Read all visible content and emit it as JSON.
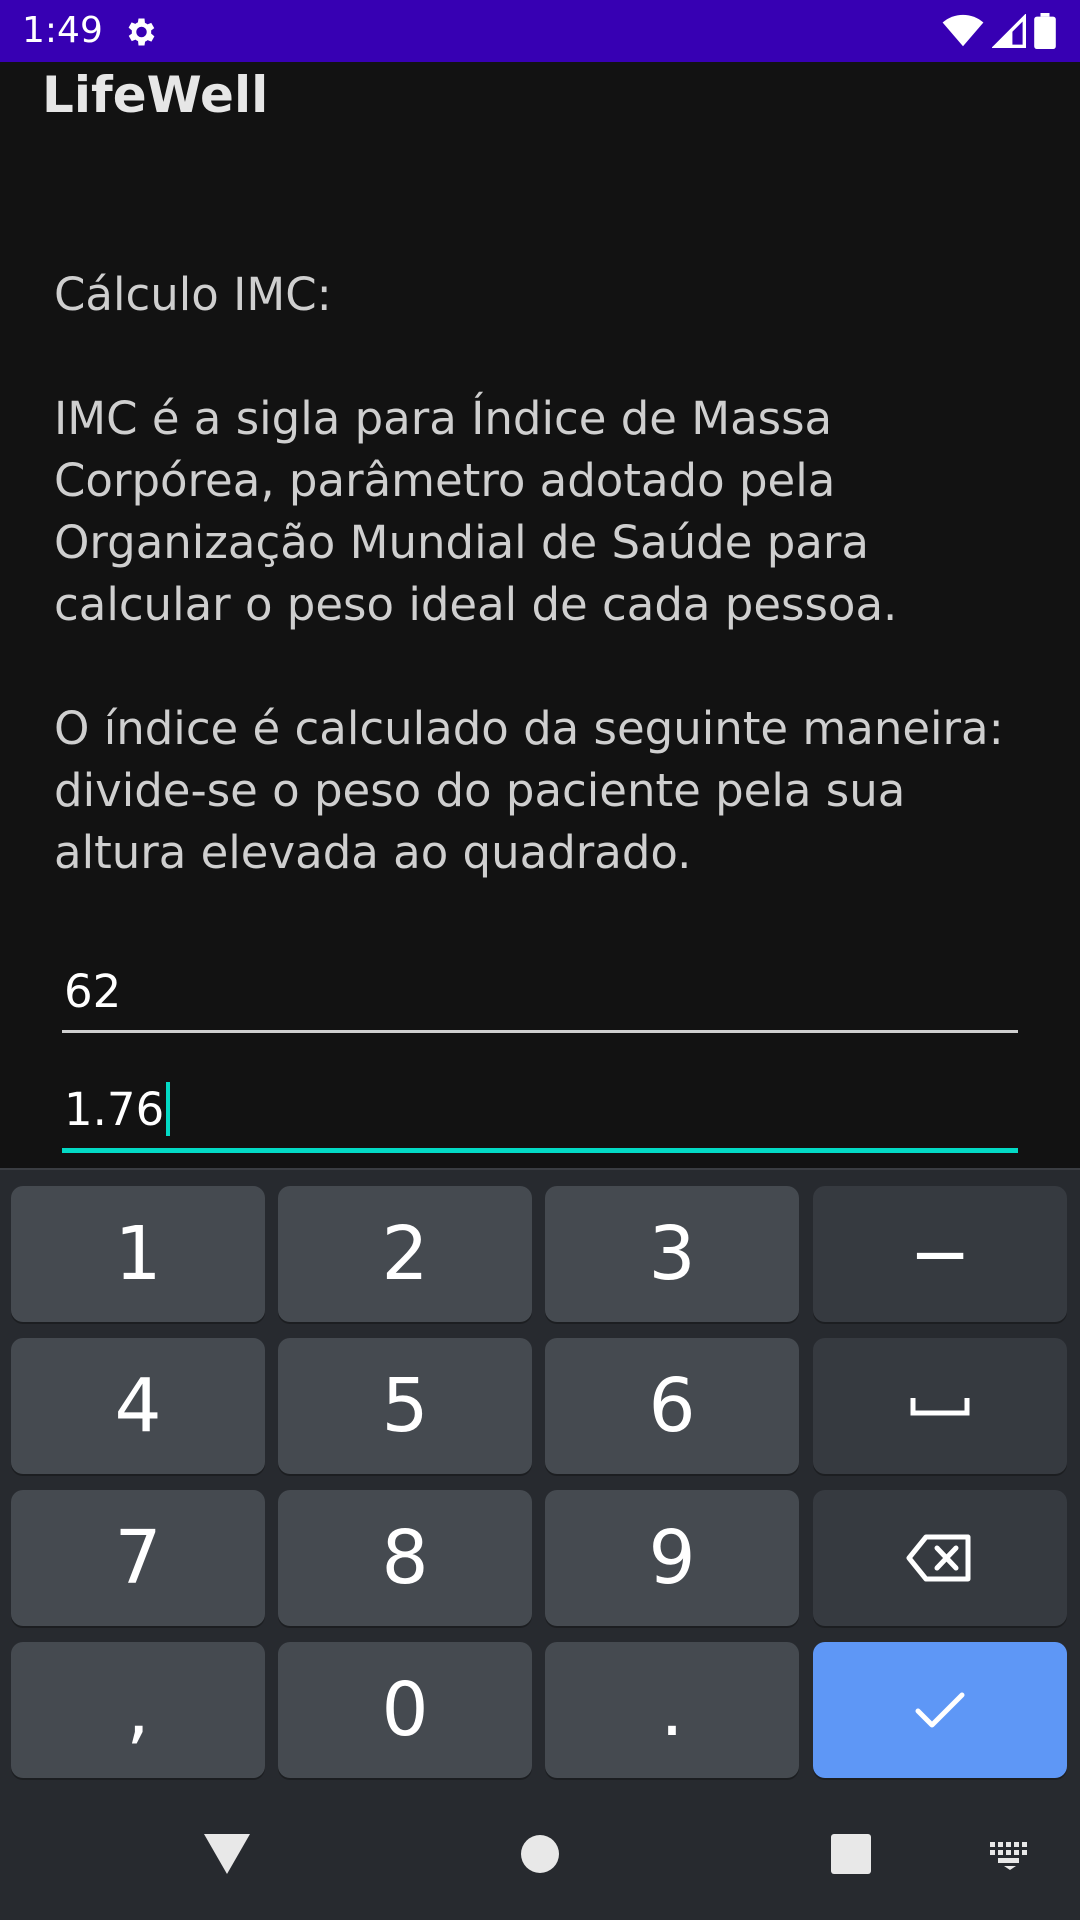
{
  "status_bar": {
    "time": "1:49",
    "icons": [
      "settings-gear-icon",
      "wifi-icon",
      "cellular-signal-icon",
      "battery-icon"
    ],
    "background": "#3700B3"
  },
  "app": {
    "title": "LifeWell"
  },
  "content": {
    "heading": "Cálculo IMC:",
    "paragraph1": "IMC é a sigla para Índice de Massa Corpórea, parâmetro adotado pela Organização Mundial de Saúde para calcular o peso ideal de cada pessoa.",
    "paragraph2": "O índice é calculado da seguinte maneira: divide-se o peso do paciente pela sua altura elevada ao quadrado."
  },
  "form": {
    "weight_value": "62",
    "height_value": "1.76",
    "accent": "#03DAC5"
  },
  "keyboard": {
    "keys": {
      "k1": "1",
      "k2": "2",
      "k3": "3",
      "minus": "−",
      "k4": "4",
      "k5": "5",
      "k6": "6",
      "k7": "7",
      "k8": "8",
      "k9": "9",
      "comma": ",",
      "k0": "0",
      "period": "."
    },
    "icons": [
      "space-icon",
      "backspace-icon",
      "checkmark-icon"
    ],
    "enter_color": "#5e97f6"
  },
  "nav_bar": {
    "icons": [
      "back-icon",
      "home-icon",
      "recents-icon",
      "keyboard-switch-icon"
    ]
  }
}
